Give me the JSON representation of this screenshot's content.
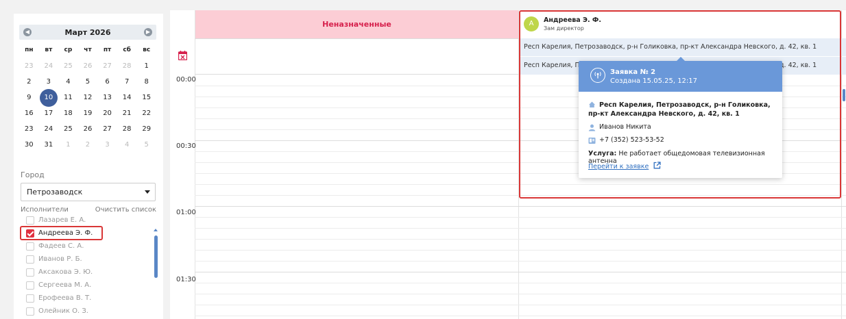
{
  "sidebar": {
    "calendar": {
      "title": "Март 2026",
      "prev_icon": "chevron-left-icon",
      "next_icon": "chevron-right-icon",
      "weekdays": [
        "пн",
        "вт",
        "ср",
        "чт",
        "пт",
        "сб",
        "вс"
      ],
      "weeks": [
        [
          {
            "d": "23",
            "m": true
          },
          {
            "d": "24",
            "m": true
          },
          {
            "d": "25",
            "m": true
          },
          {
            "d": "26",
            "m": true
          },
          {
            "d": "27",
            "m": true
          },
          {
            "d": "28",
            "m": true
          },
          {
            "d": "1"
          }
        ],
        [
          {
            "d": "2"
          },
          {
            "d": "3"
          },
          {
            "d": "4"
          },
          {
            "d": "5"
          },
          {
            "d": "6"
          },
          {
            "d": "7"
          },
          {
            "d": "8"
          }
        ],
        [
          {
            "d": "9"
          },
          {
            "d": "10",
            "sel": true
          },
          {
            "d": "11"
          },
          {
            "d": "12"
          },
          {
            "d": "13"
          },
          {
            "d": "14"
          },
          {
            "d": "15"
          }
        ],
        [
          {
            "d": "16"
          },
          {
            "d": "17"
          },
          {
            "d": "18"
          },
          {
            "d": "19"
          },
          {
            "d": "20"
          },
          {
            "d": "21"
          },
          {
            "d": "22"
          }
        ],
        [
          {
            "d": "23"
          },
          {
            "d": "24"
          },
          {
            "d": "25"
          },
          {
            "d": "26"
          },
          {
            "d": "27"
          },
          {
            "d": "28"
          },
          {
            "d": "29"
          }
        ],
        [
          {
            "d": "30"
          },
          {
            "d": "31"
          },
          {
            "d": "1",
            "m": true
          },
          {
            "d": "2",
            "m": true
          },
          {
            "d": "3",
            "m": true
          },
          {
            "d": "4",
            "m": true
          },
          {
            "d": "5",
            "m": true
          }
        ]
      ]
    },
    "city_label": "Город",
    "city_value": "Петрозаводск",
    "executors_label": "Исполнители",
    "clear_label": "Очистить список",
    "executors": [
      {
        "name": "Лазарев Е. А.",
        "checked": false
      },
      {
        "name": "Андреева Э. Ф.",
        "checked": true
      },
      {
        "name": "Фадеев С. А.",
        "checked": false
      },
      {
        "name": "Иванов Р. Б.",
        "checked": false
      },
      {
        "name": "Аксакова Э. Ю.",
        "checked": false
      },
      {
        "name": "Сергеева М. А.",
        "checked": false
      },
      {
        "name": "Ерофеева В. Т.",
        "checked": false
      },
      {
        "name": "Олейник О. З.",
        "checked": false
      }
    ]
  },
  "schedule": {
    "unassigned_label": "Неназначенные",
    "today_icon": "calendar-today-icon",
    "times": [
      "00:00",
      "00:30",
      "01:00",
      "01:30"
    ],
    "resource": {
      "avatar_letter": "А",
      "name": "Андреева Э. Ф.",
      "role": "Зам директор"
    },
    "address_rows": [
      "Респ Карелия, Петрозаводск, р-н Голиковка, пр-кт Александра Невского, д. 42, кв. 1",
      "Респ Карелия, Петрозаводск, р-н Голиковка, пр-кт Александра Невского, д. 42, кв. 1"
    ]
  },
  "popup": {
    "icon": "antenna-icon",
    "title": "Заявка № 2",
    "created": "Создана 15.05.25, 12:17",
    "address": "Респ Карелия, Петрозаводск, р-н Голиковка, пр-кт Александра Невского, д. 42, кв. 1",
    "person": "Иванов Никита",
    "phone": "+7 (352) 523-53-52",
    "service_label": "Услуга:",
    "service_value": "Не работает общедомовая телевизионная антенна",
    "link_label": "Перейти к заявке"
  },
  "colors": {
    "accent": "#3f5f9c",
    "popup_header": "#6a98d9",
    "unassigned_bg": "#fccdd5",
    "unassigned_text": "#d6204c",
    "highlight": "#d93636",
    "avatar": "#bfd64a"
  }
}
